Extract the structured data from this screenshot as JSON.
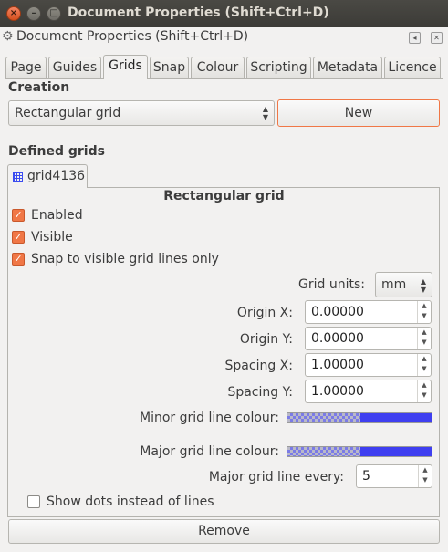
{
  "window": {
    "title": "Document Properties (Shift+Ctrl+D)",
    "close_glyph": "×",
    "minimize_glyph": "–",
    "maximize_glyph": "□"
  },
  "dock": {
    "title": "Document Properties (Shift+Ctrl+D)",
    "icon": "gear-icon",
    "iconify_glyph": "◂",
    "close_glyph": "✕"
  },
  "tabs": [
    {
      "label": "Page",
      "active": false
    },
    {
      "label": "Guides",
      "active": false
    },
    {
      "label": "Grids",
      "active": true
    },
    {
      "label": "Snap",
      "active": false
    },
    {
      "label": "Colour",
      "active": false
    },
    {
      "label": "Scripting",
      "active": false
    },
    {
      "label": "Metadata",
      "active": false
    },
    {
      "label": "Licence",
      "active": false
    }
  ],
  "creation": {
    "heading": "Creation",
    "grid_type": "Rectangular grid",
    "new_label": "New"
  },
  "defined": {
    "heading": "Defined grids",
    "grid_tab": "grid4136",
    "section_title": "Rectangular grid",
    "enabled_label": "Enabled",
    "enabled": true,
    "visible_label": "Visible",
    "visible": true,
    "snap_label": "Snap to visible grid lines only",
    "snap": true,
    "grid_units_label": "Grid units:",
    "grid_units": "mm",
    "origin_x_label": "Origin X:",
    "origin_x": "0.00000",
    "origin_y_label": "Origin Y:",
    "origin_y": "0.00000",
    "spacing_x_label": "Spacing X:",
    "spacing_x": "1.00000",
    "spacing_y_label": "Spacing Y:",
    "spacing_y": "1.00000",
    "minor_colour_label": "Minor grid line colour:",
    "minor_colour": "#3f3ff0",
    "major_colour_label": "Major grid line colour:",
    "major_colour": "#3f3ff0",
    "major_every_label": "Major grid line every:",
    "major_every": "5",
    "dots_label": "Show dots instead of lines",
    "dots": false
  },
  "remove_label": "Remove",
  "colors": {
    "accent": "#f07746",
    "titlebar": "#3c3b37"
  }
}
